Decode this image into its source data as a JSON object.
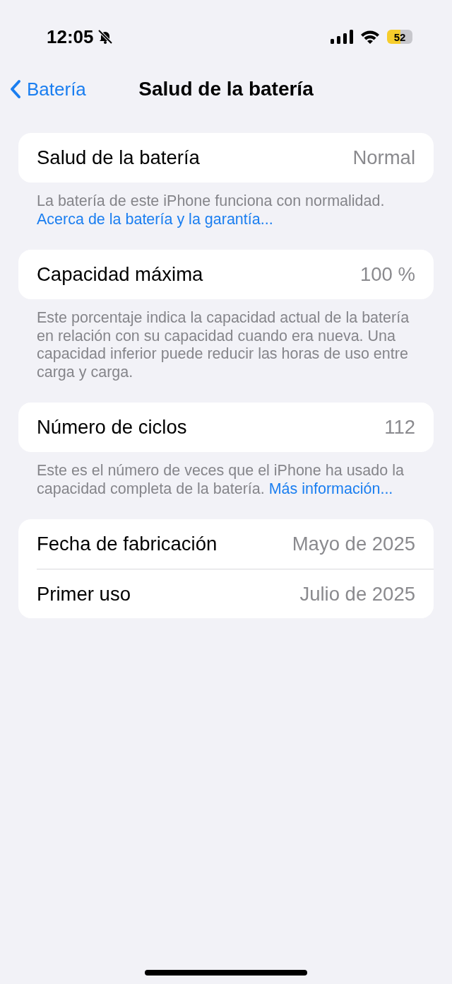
{
  "status_bar": {
    "time": "12:05",
    "silent": true,
    "battery": "52",
    "low_power_mode": true
  },
  "nav": {
    "back": "Batería",
    "title": "Salud de la batería"
  },
  "groups": [
    {
      "rows": [
        {
          "label": "Salud de la batería",
          "value": "Normal"
        }
      ],
      "footer": [
        {
          "kind": "text",
          "text": "La batería de este iPhone funciona con normalidad."
        },
        {
          "kind": "link",
          "text": "Acerca de la batería y la garantía..."
        }
      ]
    },
    {
      "rows": [
        {
          "label": "Capacidad máxima",
          "value": "100 %"
        }
      ],
      "footer": [
        {
          "kind": "text",
          "text": "Este porcentaje indica la capacidad actual de la batería en relación con su capacidad cuando era nueva. Una capacidad inferior puede reducir las horas de uso entre carga y carga."
        }
      ]
    },
    {
      "rows": [
        {
          "label": "Número de ciclos",
          "value": "112"
        }
      ],
      "footer": [
        {
          "kind": "text",
          "text": "Este es el número de veces que el iPhone ha usado la capacidad completa de la batería."
        },
        {
          "kind": "link",
          "text": "Más información..."
        }
      ]
    },
    {
      "rows": [
        {
          "label": "Fecha de fabricación",
          "value": "Mayo de 2025"
        },
        {
          "label": "Primer uso",
          "value": "Julio de 2025"
        }
      ]
    }
  ]
}
